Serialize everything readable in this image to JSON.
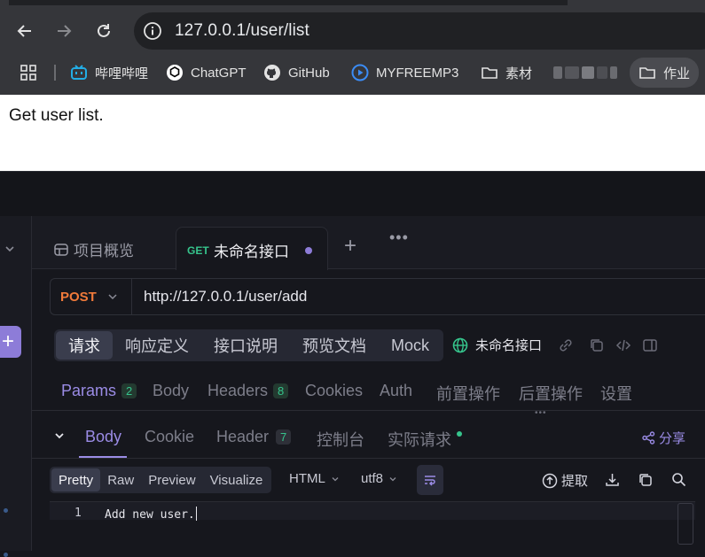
{
  "browser": {
    "url": "127.0.0.1/user/list",
    "bookmarks": [
      {
        "label": "哔哩哔哩",
        "icon": "bilibili-icon"
      },
      {
        "label": "ChatGPT",
        "icon": "chatgpt-icon"
      },
      {
        "label": "GitHub",
        "icon": "github-icon"
      },
      {
        "label": "MYFREEMP3",
        "icon": "myfreemp3-icon"
      },
      {
        "label": "素材",
        "icon": "folder-icon"
      },
      {
        "label": "作业",
        "icon": "folder-icon"
      }
    ]
  },
  "page": {
    "body_text": "Get user list."
  },
  "app": {
    "tabs": {
      "overview": "项目概览",
      "active_method": "GET",
      "active_name": "未命名接口"
    },
    "request": {
      "method": "POST",
      "url": "http://127.0.0.1/user/add"
    },
    "segments": [
      "请求",
      "响应定义",
      "接口说明",
      "预览文档",
      "Mock"
    ],
    "api_name": "未命名接口",
    "param_tabs": [
      {
        "label": "Params",
        "badge": "2"
      },
      {
        "label": "Body",
        "badge": ""
      },
      {
        "label": "Headers",
        "badge": "8"
      },
      {
        "label": "Cookies",
        "badge": ""
      },
      {
        "label": "Auth",
        "badge": ""
      },
      {
        "label": "前置操作",
        "badge": ""
      },
      {
        "label": "后置操作",
        "badge": ""
      },
      {
        "label": "设置",
        "badge": ""
      }
    ],
    "response_tabs": {
      "body": "Body",
      "cookie": "Cookie",
      "header": "Header",
      "header_badge": "7",
      "console": "控制台",
      "actual_request": "实际请求"
    },
    "share": "分享",
    "view_modes": [
      "Pretty",
      "Raw",
      "Preview",
      "Visualize"
    ],
    "format": "HTML",
    "encoding": "utf8",
    "extract": "提取",
    "editor": {
      "line_number": "1",
      "content": "Add new user."
    },
    "colors": {
      "accent": "#9b8ce6",
      "post": "#f07a3a",
      "get": "#36c48c"
    }
  }
}
